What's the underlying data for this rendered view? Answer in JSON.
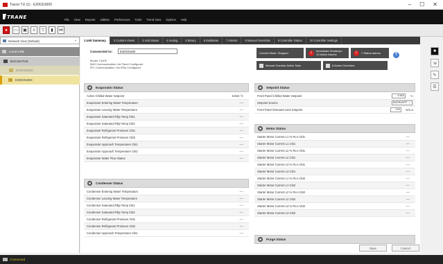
{
  "window": {
    "title": "Tracer TU (1) - E20G01600"
  },
  "brand": {
    "logo": "TRANE"
  },
  "menu": [
    "File",
    "View",
    "Reports",
    "Utilities",
    "Preferences",
    "Tools",
    "Trend View",
    "Options",
    "Help"
  ],
  "nav": {
    "view_label": "Network View (Default)",
    "items": [
      "Local USB",
      "BACnet Port",
      "E20G01600",
      "E20G01600"
    ]
  },
  "tabs": [
    "1 Unit Summary",
    "2 Custom Views",
    "3 Unit Status",
    "4 Analog",
    "5 Binary",
    "6 Multistate",
    "7 Alarms",
    "8 Manual Overrides",
    "9 Controller Status",
    "10 Controller Settings"
  ],
  "header": {
    "connected_label": "Connected to:",
    "connected_value": "E20G01600",
    "model_lines": [
      "Model:  CDHF",
      "BAS Communication:  No Panel Configured",
      "IPC Communication:  No IPAs Configured"
    ],
    "current_mode": "Current Mode: Stopped",
    "immediate_shutdown": "Immediate Shutdown\n10 Active Alarms",
    "immediate_badge": "!",
    "status_alarms": "7 Status Alarms",
    "status_badge": "!",
    "manual_override": "Manual Override Active Tabs",
    "active_overrides": "8 Active Overrides"
  },
  "evaporator": {
    "title": "Evaporator Status",
    "rows": [
      {
        "label": "Active Chilled Water Setpoint",
        "value": "6.664 °C"
      },
      {
        "label": "Evaporator Entering Water Temperature",
        "value": "----"
      },
      {
        "label": "Evaporator Leaving Water Temperature",
        "value": "----"
      },
      {
        "label": "Evaporator Saturated Rfgt Temp Ckt1",
        "value": "----"
      },
      {
        "label": "Evaporator Saturated Rfgt Temp Ckt2",
        "value": "----"
      },
      {
        "label": "Evaporator Refrigerant Pressure Ckt1",
        "value": "----"
      },
      {
        "label": "Evaporator Refrigerant Pressure Ckt2",
        "value": "----"
      },
      {
        "label": "Evaporator Approach Temperature Ckt1",
        "value": "----"
      },
      {
        "label": "Evaporator Approach Temperature Ckt2",
        "value": "----"
      },
      {
        "label": "Evaporator Water Flow Status",
        "value": "----"
      }
    ]
  },
  "condenser": {
    "title": "Condenser Status",
    "rows": [
      {
        "label": "Condenser Entering Water Temperature",
        "value": "----"
      },
      {
        "label": "Condenser Leaving Water Temperature",
        "value": "----"
      },
      {
        "label": "Condenser Saturated Rfgt Temp Ckt1",
        "value": "----"
      },
      {
        "label": "Condenser Saturated Rfgt Temp Ckt2",
        "value": "----"
      },
      {
        "label": "Condenser Refrigerant Pressure Ckt1",
        "value": "----"
      },
      {
        "label": "Condenser Refrigerant Pressure Ckt2",
        "value": "----"
      },
      {
        "label": "Condenser Approach Temperature Ckt1",
        "value": "----"
      }
    ]
  },
  "setpoint": {
    "title": "Setpoint Status",
    "rows": [
      {
        "label": "Front Panel Chilled Water Setpoint",
        "value": "6.664",
        "unit": "°C"
      },
      {
        "label": "Setpoint Source",
        "value": "BAS/Ext/FP"
      },
      {
        "label": "Front Panel Demand Limit Setpoint",
        "value": "100",
        "unit": "%RLA"
      }
    ]
  },
  "motor": {
    "title": "Motor Status",
    "rows": [
      {
        "label": "Starter Motor Current L1 % RLA Ckt1",
        "value": "----"
      },
      {
        "label": "Starter Motor Current L1 Ckt1",
        "value": "----"
      },
      {
        "label": "Starter Motor Current L2 % RLA Ckt1",
        "value": "----"
      },
      {
        "label": "Starter Motor Current L2 Ckt1",
        "value": "----"
      },
      {
        "label": "Starter Motor Current L3 % RLA Ckt1",
        "value": "----"
      },
      {
        "label": "Starter Motor Current L3 Ckt1",
        "value": "----"
      },
      {
        "label": "Starter Motor Current L1 % RLA Ckt2",
        "value": "----"
      },
      {
        "label": "Starter Motor Current L1 Ckt2",
        "value": "----"
      },
      {
        "label": "Starter Motor Current L2 % RLA Ckt2",
        "value": "----"
      },
      {
        "label": "Starter Motor Current L2 Ckt2",
        "value": "----"
      },
      {
        "label": "Starter Motor Current L3 % RLA Ckt2",
        "value": "----"
      },
      {
        "label": "Starter Motor Current L3 Ckt2",
        "value": "----"
      }
    ]
  },
  "purge": {
    "title": "Purge Status"
  },
  "footer": {
    "save": "Save",
    "cancel": "Cancel"
  },
  "status_bar": {
    "text": "Connected"
  },
  "colors": {
    "alert_red": "#d62020",
    "accent_blue": "#4a80d0",
    "status_text": "#d8c020"
  }
}
